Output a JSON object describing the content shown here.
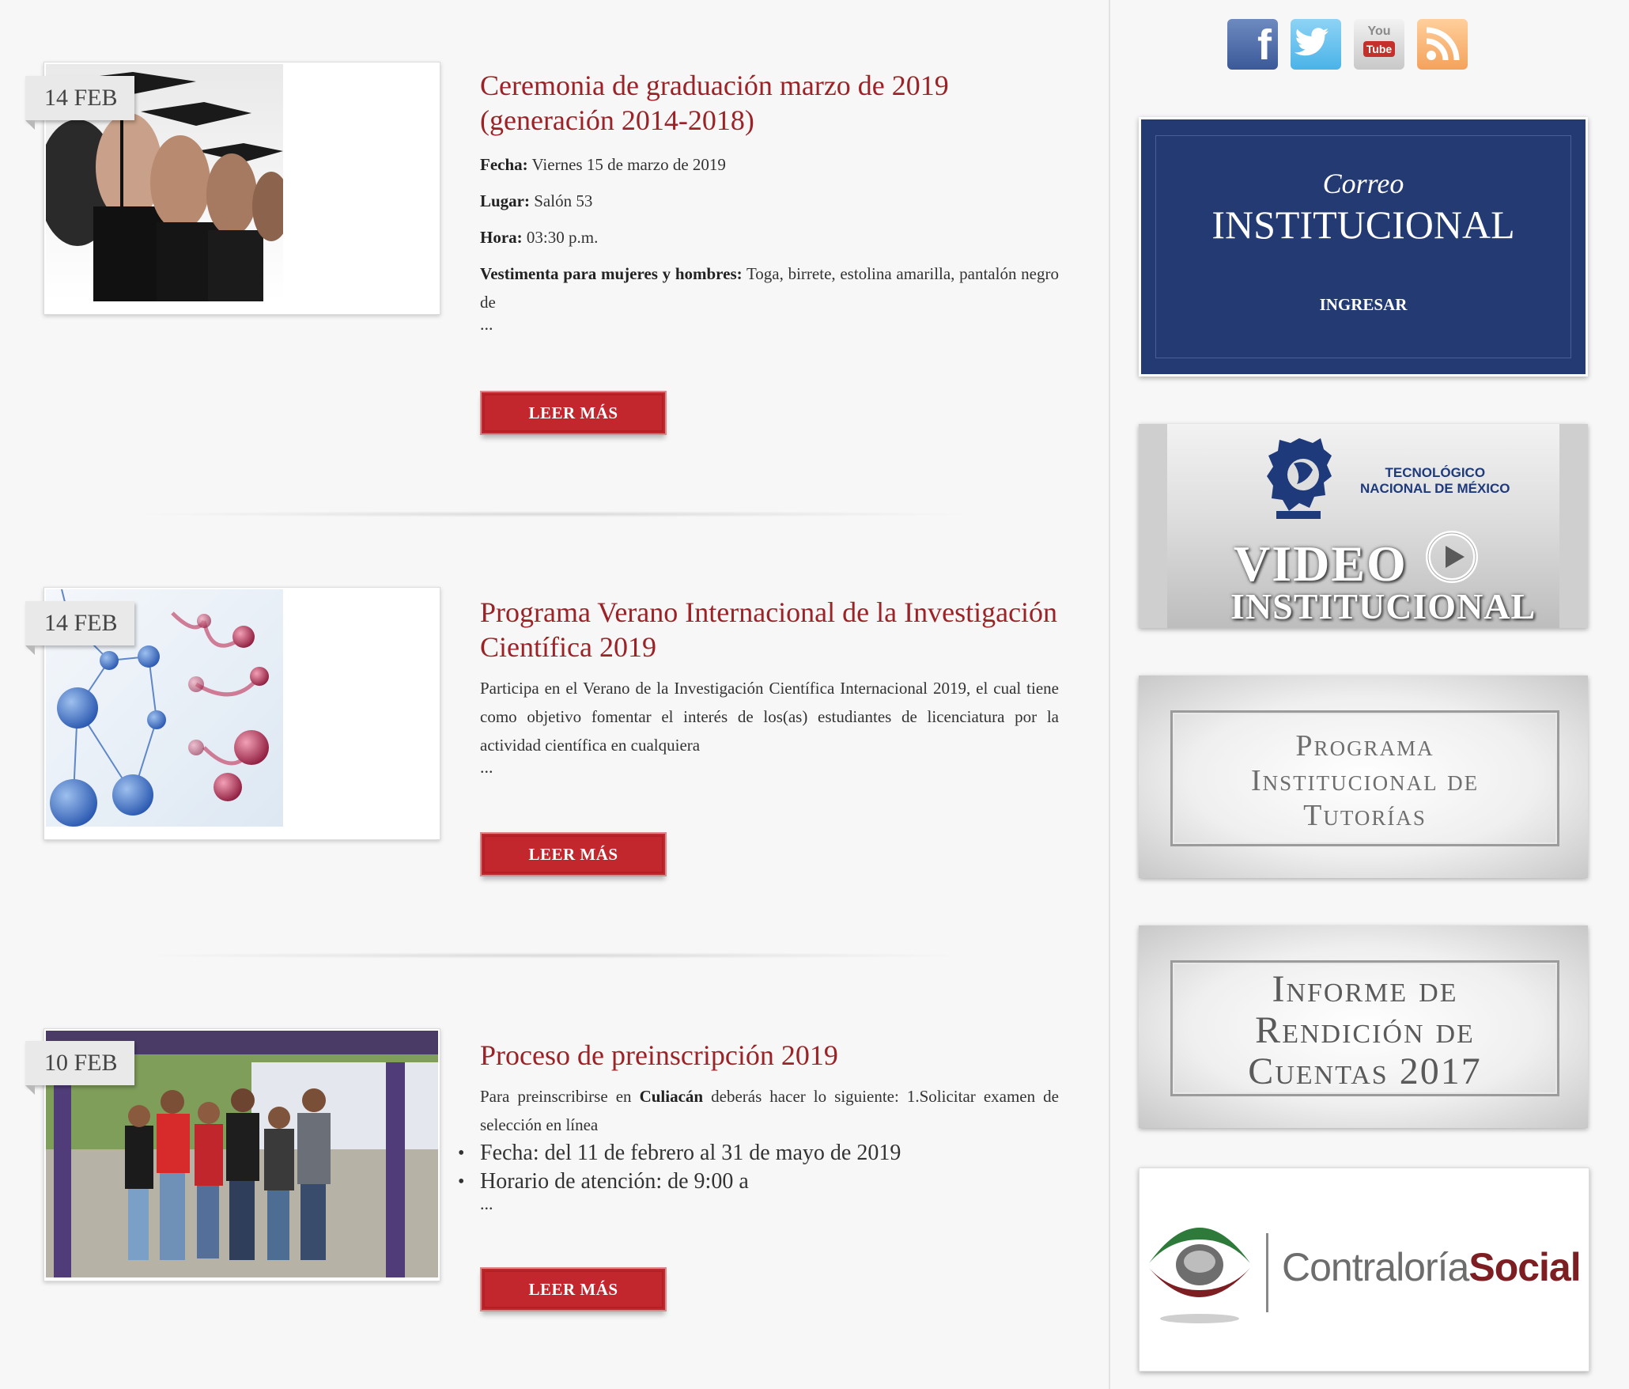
{
  "posts": [
    {
      "date": "14 FEB",
      "title_line1": "Ceremonia de graduación marzo de 2019",
      "title_line2": "(generación 2014-2018)",
      "fields": [
        {
          "label": "Fecha:",
          "value": " Viernes 15 de marzo de 2019"
        },
        {
          "label": "Lugar:",
          "value": " Salón 53"
        },
        {
          "label": "Hora:",
          "value": " 03:30 p.m."
        },
        {
          "label": "Vestimenta para mujeres y hombres:",
          "value": " Toga, birrete, estolina amarilla, pantalón negro de"
        }
      ],
      "ellipsis": "...",
      "button": "LEER MÁS"
    },
    {
      "date": "14 FEB",
      "title_line1": "Programa Verano Internacional de la Investigación",
      "title_line2": "Científica 2019",
      "body": "Participa en el Verano de la Investigación Científica Internacional 2019, el cual tiene como objetivo fomentar el interés de los(as) estudiantes de licenciatura por la actividad científica en cualquiera",
      "ellipsis": "...",
      "button": "LEER MÁS"
    },
    {
      "date": "10 FEB",
      "title_line1": "Proceso de preinscripción 2019",
      "body_pre": "Para preinscribirse en ",
      "body_bold": "Culiacán",
      "body_post": " deberás hacer lo siguiente: 1.Solicitar examen de selección en línea",
      "bullets": [
        "Fecha: del 11 de febrero al 31 de mayo de 2019",
        "Horario de atención: de 9:00 a"
      ],
      "ellipsis": "...",
      "button": "LEER MÁS"
    }
  ],
  "sidebar": {
    "social": [
      {
        "name": "facebook-icon",
        "glyph": "f"
      },
      {
        "name": "twitter-icon",
        "glyph": "t"
      },
      {
        "name": "youtube-icon",
        "glyph": "You Tube"
      },
      {
        "name": "rss-icon",
        "glyph": "rss"
      }
    ],
    "correo": {
      "line1": "Correo",
      "line2": "INSTITUCIONAL",
      "link": "INGRESAR"
    },
    "video": {
      "org_line1": "TECNOLÓGICO",
      "org_line2": "NACIONAL DE MÉXICO",
      "line1": "VIDEO",
      "line2": "INSTITUCIONAL"
    },
    "tutorias": {
      "line1": "Programa",
      "line2": "Institucional de",
      "line3": "Tutorías"
    },
    "informe": {
      "line1": "Informe de",
      "line2": "Rendición de",
      "line3": "Cuentas 2017"
    },
    "contraloria": {
      "part1": "Contraloría",
      "part2": "Social"
    }
  },
  "colors": {
    "accent": "#9b2226",
    "button": "#c1272d",
    "correo_bg": "#233a73"
  }
}
